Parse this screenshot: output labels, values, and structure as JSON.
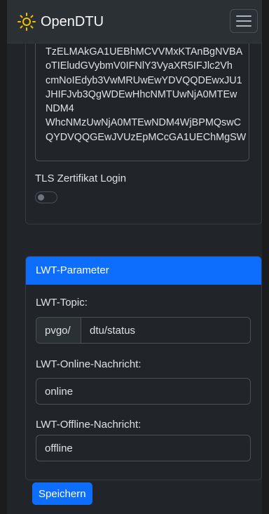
{
  "navbar": {
    "brand": "OpenDTU",
    "menu_icon": "hamburger-menu-icon",
    "brand_icon": "sun-icon"
  },
  "certificate": {
    "lines": [
      "TzELMAkGA1UEBhMCVVMxKTAnBgNVBA",
      "oTIEludGVybmV0IFNlY3VyaXR5IFJlc2Vh",
      "cmNoIEdyb3VwMRUwEwYDVQQDEwxJU1",
      "JHIFJvb3QgWDEwHhcNMTUwNjA0MTEw",
      "NDM4",
      "WhcNMzUwNjA0MTEwNDM4WjBPMQswC",
      "QYDVQQGEwJVUzEpMCcGA1UEChMgSW"
    ]
  },
  "tls": {
    "label": "TLS Zertifikat Login",
    "enabled": false
  },
  "lwt": {
    "header": "LWT-Parameter",
    "topic_label": "LWT-Topic:",
    "topic_prefix": "pvgo/",
    "topic_value": "dtu/status",
    "online_label": "LWT-Online-Nachricht:",
    "online_value": "online",
    "offline_label": "LWT-Offline-Nachricht:",
    "offline_value": "offline"
  },
  "actions": {
    "save_label": "Speichern"
  },
  "colors": {
    "accent": "#0d6efd",
    "background": "#212529",
    "navbar": "#2b3035"
  }
}
